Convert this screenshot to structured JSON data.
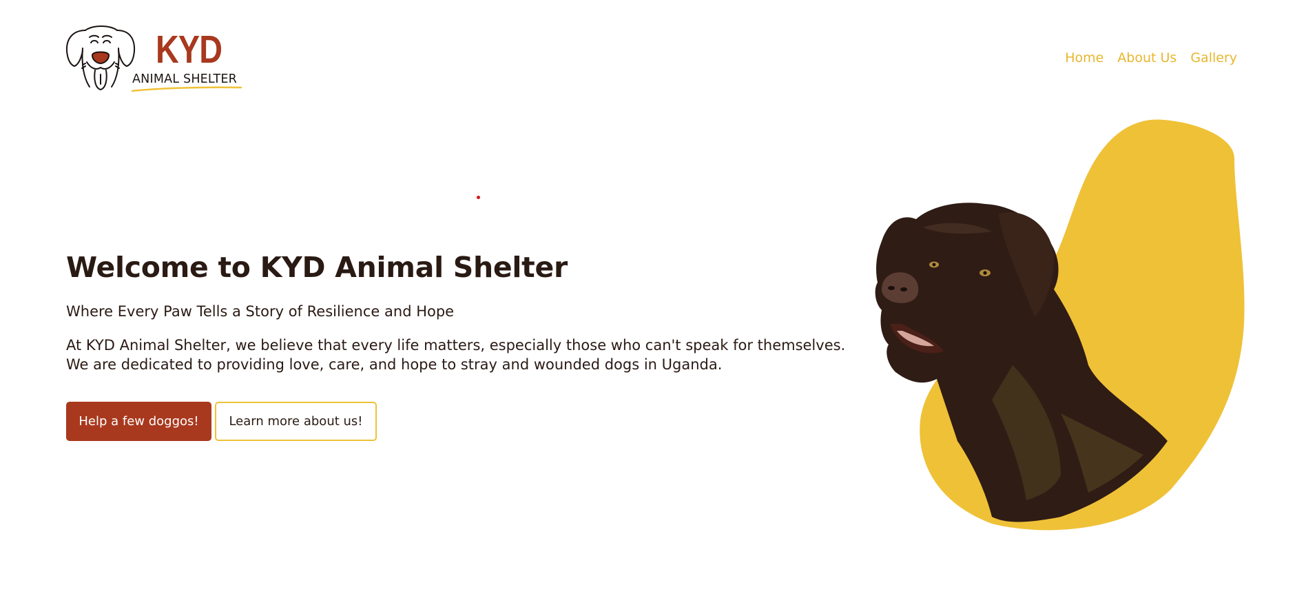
{
  "header": {
    "logo": {
      "brand": "KYD",
      "subtitle": "ANIMAL SHELTER",
      "brand_color": "#a8391e"
    },
    "nav": [
      {
        "label": "Home"
      },
      {
        "label": "About Us"
      },
      {
        "label": "Gallery"
      }
    ],
    "nav_color": "#e8b62e"
  },
  "hero": {
    "title": "Welcome to KYD Animal Shelter",
    "subtitle": "Where Every Paw Tells a Story of Resilience and Hope",
    "description_line1": "At KYD Animal Shelter, we believe that every life matters, especially those who can't speak for themselves.",
    "description_line2": "We are dedicated to providing love, care, and hope to stray and wounded dogs in Uganda.",
    "primary_button": "Help a few doggos!",
    "secondary_button": "Learn more about us!",
    "image_icon": "labrador-dog-photo",
    "blob_color": "#efc137"
  }
}
